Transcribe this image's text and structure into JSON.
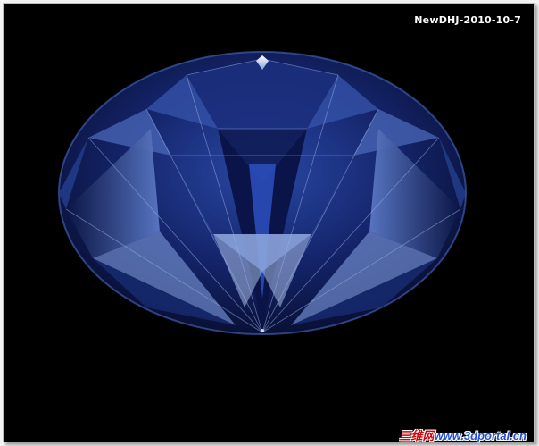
{
  "image": {
    "subject": "blue-diamond",
    "date_stamp": "NewDHJ-2010-10-7",
    "watermark_cn": "三维网",
    "watermark_url": "www.3dportal.cn",
    "colors": {
      "background": "#000000",
      "gem_dark": "#0a1440",
      "gem_mid": "#243f96",
      "gem_light": "#7e9ad4",
      "gem_highlight": "#d8e2f6",
      "watermark_cn": "#d4000b",
      "watermark_url": "#1f4fd0"
    }
  }
}
